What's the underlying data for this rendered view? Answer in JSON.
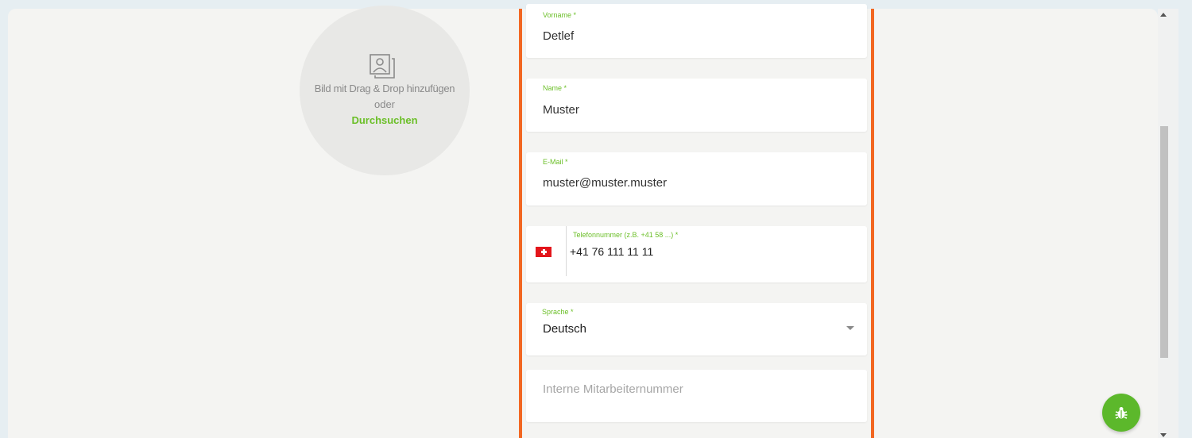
{
  "upload": {
    "line1": "Bild mit Drag & Drop hinzufügen",
    "line2": "oder",
    "browse": "Durchsuchen",
    "icon": "image-upload-icon"
  },
  "form": {
    "firstname": {
      "label": "Vorname *",
      "value": "Detlef"
    },
    "lastname": {
      "label": "Name *",
      "value": "Muster"
    },
    "email": {
      "label": "E-Mail *",
      "value": "muster@muster.muster"
    },
    "phone": {
      "label": "Telefonnummer (z.B. +41 58 ...) *",
      "value": "+41 76 111 11 11",
      "country_icon": "swiss-flag-icon"
    },
    "language": {
      "label": "Sprache *",
      "value": "Deutsch"
    },
    "employee_number": {
      "placeholder": "Interne Mitarbeiternummer",
      "value": ""
    }
  },
  "colors": {
    "accent_green": "#6bbf28",
    "border_orange": "#f26722",
    "bug_button": "#5cb82b"
  },
  "bug_button": {
    "icon": "bug-icon"
  }
}
